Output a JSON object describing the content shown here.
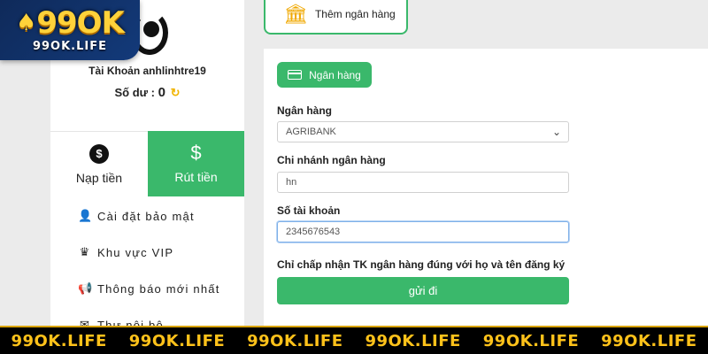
{
  "logo": {
    "main": "99OK",
    "sub": "99OK.LIFE"
  },
  "account": {
    "label": "Tài Khoản anhlinhtre19",
    "balance_label": "Số dư : ",
    "balance_value": "0",
    "refresh_icon": "↻"
  },
  "tabs": [
    {
      "label": "Nạp tiền",
      "icon": "coin-icon",
      "glyph": "$"
    },
    {
      "label": "Rút tiền",
      "icon": "hand-money-icon",
      "glyph": "$"
    }
  ],
  "menu": [
    {
      "label": "Cài đặt bảo mật",
      "icon": "user-lock-icon",
      "glyph": "👤"
    },
    {
      "label": "Khu vực VIP",
      "icon": "vip-crown-icon",
      "glyph": "♛"
    },
    {
      "label": "Thông báo mới nhất",
      "icon": "megaphone-icon",
      "glyph": "📢"
    },
    {
      "label": "Thư nội bộ",
      "icon": "mail-icon",
      "glyph": "✉"
    }
  ],
  "add_bank": {
    "label": "Thêm ngân hàng",
    "glyph": "🏛"
  },
  "form": {
    "pill_label": "Ngân hàng",
    "bank_label": "Ngân hàng",
    "bank_value": "AGRIBANK",
    "branch_label": "Chi nhánh ngân hàng",
    "branch_value": "hn",
    "account_label": "Số tài khoản",
    "account_value": "2345676543",
    "notice": "Chỉ chấp nhận TK ngân hàng đúng với họ và tên đăng ký",
    "submit_label": "gửi đi"
  },
  "banner": [
    "99OK.LIFE",
    "99OK.LIFE",
    "99OK.LIFE",
    "99OK.LIFE",
    "99OK.LIFE",
    "99OK.LIFE"
  ],
  "colors": {
    "accent": "#3ab86b",
    "gold": "#ffc21a",
    "banner_bg": "#000000"
  }
}
